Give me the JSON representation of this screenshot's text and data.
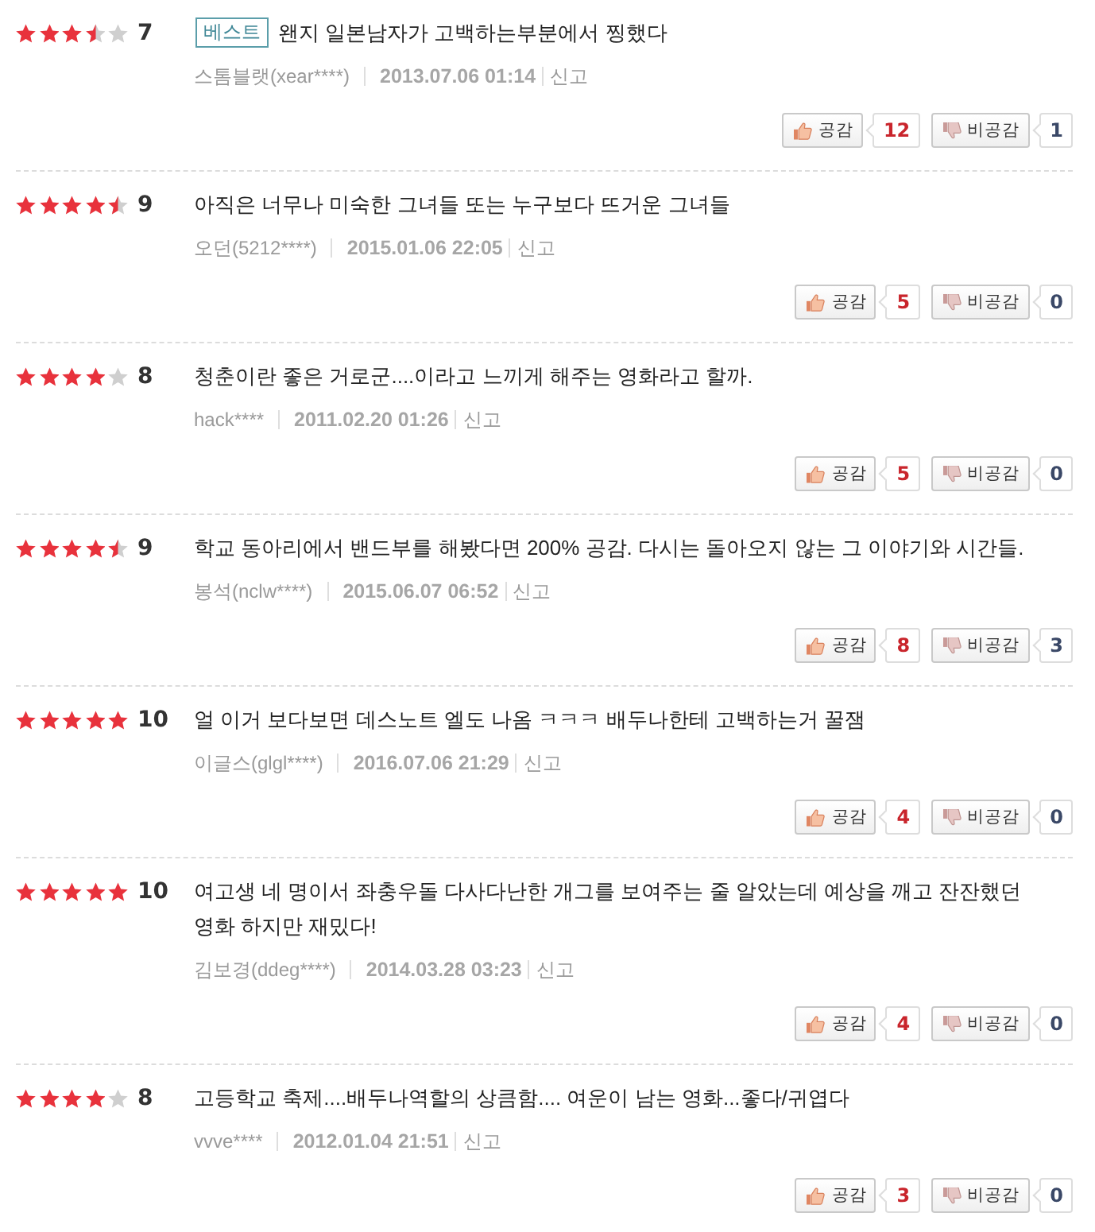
{
  "reviews": [
    {
      "stars": 3.5,
      "score": "7",
      "badge": "베스트",
      "text": "왠지 일본남자가 고백하는부분에서 찡했다",
      "author": "스톰블랫(xear****)",
      "date": "2013.07.06 01:14",
      "report": "신고",
      "like_label": "공감",
      "likes": "12",
      "dislike_label": "비공감",
      "dislikes": "1"
    },
    {
      "stars": 4.5,
      "score": "9",
      "text": "아직은 너무나 미숙한 그녀들 또는 누구보다 뜨거운 그녀들",
      "author": "오던(5212****)",
      "date": "2015.01.06 22:05",
      "report": "신고",
      "like_label": "공감",
      "likes": "5",
      "dislike_label": "비공감",
      "dislikes": "0"
    },
    {
      "stars": 4,
      "score": "8",
      "text": "청춘이란 좋은 거로군....이라고 느끼게 해주는 영화라고 할까.",
      "author": "hack****",
      "date": "2011.02.20 01:26",
      "report": "신고",
      "like_label": "공감",
      "likes": "5",
      "dislike_label": "비공감",
      "dislikes": "0"
    },
    {
      "stars": 4.5,
      "score": "9",
      "text": "학교 동아리에서 밴드부를 해봤다면 200% 공감. 다시는 돌아오지 않는 그 이야기와 시간들.",
      "author": "봉석(nclw****)",
      "date": "2015.06.07 06:52",
      "report": "신고",
      "like_label": "공감",
      "likes": "8",
      "dislike_label": "비공감",
      "dislikes": "3"
    },
    {
      "stars": 5,
      "score": "10",
      "text": "얼 이거 보다보면 데스노트 엘도 나옴 ㅋㅋㅋ 배두나한테 고백하는거 꿀잼",
      "author": "이글스(glgl****)",
      "date": "2016.07.06 21:29",
      "report": "신고",
      "like_label": "공감",
      "likes": "4",
      "dislike_label": "비공감",
      "dislikes": "0"
    },
    {
      "stars": 5,
      "score": "10",
      "text": "여고생 네 명이서 좌충우돌 다사다난한 개그를 보여주는 줄 알았는데 예상을 깨고 잔잔했던 영화 하지만 재밌다!",
      "author": "김보경(ddeg****)",
      "date": "2014.03.28 03:23",
      "report": "신고",
      "like_label": "공감",
      "likes": "4",
      "dislike_label": "비공감",
      "dislikes": "0"
    },
    {
      "stars": 4,
      "score": "8",
      "text": "고등학교 축제....배두나역할의 상큼함.... 여운이 남는 영화...좋다/귀엽다",
      "author": "vvve****",
      "date": "2012.01.04 21:51",
      "report": "신고",
      "like_label": "공감",
      "likes": "3",
      "dislike_label": "비공감",
      "dislikes": "0"
    }
  ]
}
